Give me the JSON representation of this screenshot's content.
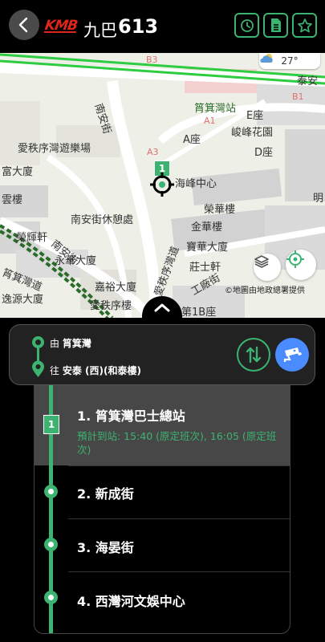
{
  "header": {
    "logo_text": "KMB",
    "company": "九巴",
    "route_number": "613"
  },
  "map": {
    "weather_temp": "27°",
    "attribution": "©地圖由地政總署提供",
    "labels": {
      "b3": "B3",
      "tai_on": "泰安",
      "b1": "B1",
      "shau_kei_wan_station": "筲箕灣站",
      "e_block": "E座",
      "a1": "A1",
      "nam_on_street": "南安街",
      "kwan_fung_garden": "峻峰花園",
      "oi_chat_playground": "愛秩序灣遊樂場",
      "a_block": "A座",
      "d_block": "D座",
      "a3": "A3",
      "fu_tai_building": "富大廈",
      "hoi_fung_centre": "海峰中心",
      "wan_building": "雲樓",
      "wing_wah_building": "榮華樓",
      "nam_on_rest": "南安街休憩處",
      "ming": "明",
      "kam_wah_building": "金華樓",
      "wing_fai_hin": "榮輝軒",
      "po_wah_building": "寶華大廈",
      "wing_wah_tower": "永華大廈",
      "chong_sze_hin": "莊士軒",
      "kwai_wah_street": "筲箕灣道",
      "ka_yue_building": "嘉裕大廈",
      "yat_shing_building": "逸源大廈",
      "oi_chat_building": "愛秩序樓",
      "factory_street": "工廠街",
      "oi_chat_road": "愛秩序灣道",
      "block_1b": "第1B座",
      "nam_on_street_2": "南安街"
    },
    "flag_number": "1"
  },
  "direction": {
    "from_prefix": "由",
    "from": "筲箕灣",
    "to_prefix": "往",
    "to": "安泰 (西)(和泰樓)"
  },
  "stops": [
    {
      "label": "1. 筲箕灣巴士總站",
      "eta": "預計到站: 15:40 (原定班次), 16:05 (原定班次)",
      "flag": "1"
    },
    {
      "label": "2. 新成街"
    },
    {
      "label": "3. 海晏街"
    },
    {
      "label": "4. 西灣河文娛中心"
    }
  ],
  "colors": {
    "accent": "#3cb371",
    "brand_red": "#e1251b",
    "camera_blue": "#4a8cff"
  }
}
